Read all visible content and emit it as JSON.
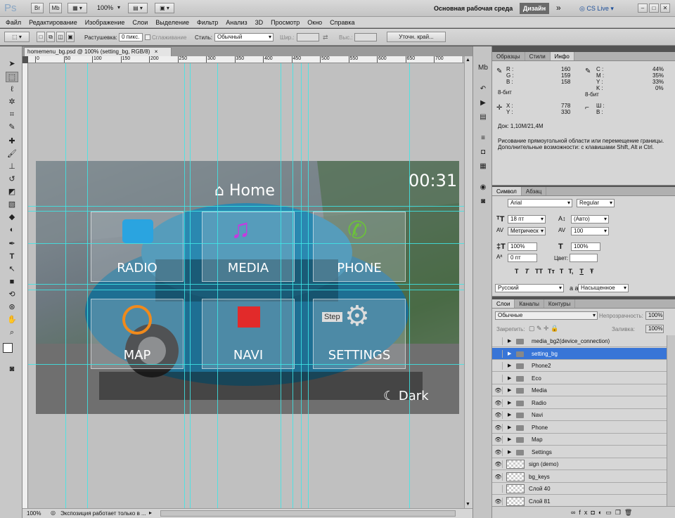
{
  "app": {
    "logo": "Ps",
    "bridge": "Br",
    "mini": "Mb",
    "zoom": "100%",
    "workspace": "Основная рабочая среда",
    "design_btn": "Дизайн",
    "cs_live": "CS Live"
  },
  "menu": [
    "Файл",
    "Редактирование",
    "Изображение",
    "Слои",
    "Выделение",
    "Фильтр",
    "Анализ",
    "3D",
    "Просмотр",
    "Окно",
    "Справка"
  ],
  "options": {
    "feather_label": "Растушевка:",
    "feather_value": "0 пикс.",
    "antialias": "Сглаживание",
    "style_label": "Стиль:",
    "style_value": "Обычный",
    "width_label": "Шир.:",
    "height_label": "Выс.:",
    "refine_btn": "Уточн. край..."
  },
  "document": {
    "tab_title": "homemenu_bg.psd @ 100% (setting_bg, RGB/8)",
    "ruler_marks": [
      "0",
      "50",
      "100",
      "150",
      "200",
      "250",
      "300",
      "350",
      "400",
      "450",
      "500",
      "550",
      "600",
      "650",
      "700",
      "750",
      "800"
    ],
    "status_zoom": "100%",
    "status_text": "Экспозиция работает только в ..."
  },
  "mock_screen": {
    "home": "Home",
    "clock": "00:31",
    "tiles": [
      "RADIO",
      "MEDIA",
      "PHONE",
      "MAP",
      "NAVI",
      "SETTINGS"
    ],
    "dark": "Dark",
    "steps_text": "Step"
  },
  "info_panel": {
    "tabs": [
      "Образцы",
      "Стили",
      "Инфо"
    ],
    "r_label": "R :",
    "r": "160",
    "g_label": "G :",
    "g": "159",
    "b_label": "B :",
    "b": "158",
    "bits1": "8-бит",
    "c_label": "C :",
    "c": "44%",
    "m_label": "M :",
    "m": "35%",
    "y_label": "Y :",
    "y": "33%",
    "k_label": "K :",
    "k": "0%",
    "bits2": "8-бит",
    "x_label": "X :",
    "x": "778",
    "y2_label": "Y :",
    "y2": "330",
    "w_label": "Ш :",
    "h_label": "В :",
    "doc": "Док: 1,10M/21,4M",
    "hint1": "Рисование прямоугольной области или перемещение границы.",
    "hint2": "Дополнительные возможности: с клавишами Shift, Alt и Ctrl."
  },
  "char_panel": {
    "tabs": [
      "Символ",
      "Абзац"
    ],
    "font": "Arial",
    "style": "Regular",
    "size": "18 пт",
    "leading": "(Авто)",
    "kerning": "Метрическ",
    "tracking": "100",
    "vscale": "100%",
    "hscale": "100%",
    "baseline": "0 пт",
    "color_label": "Цвет:",
    "lang": "Русский",
    "aa_label": "a a",
    "aa": "Насыщенное",
    "styles": [
      "T",
      "T",
      "TT",
      "Tт",
      "T",
      "T,",
      "T",
      "Ŧ"
    ]
  },
  "layers_panel": {
    "tabs": [
      "Слои",
      "Каналы",
      "Контуры"
    ],
    "blend": "Обычные",
    "opacity_label": "Непрозрачность:",
    "opacity": "100%",
    "lock_label": "Закрепить:",
    "fill_label": "Заливка:",
    "fill": "100%",
    "layers": [
      {
        "name": "media_bg2(device_connection)",
        "type": "folder",
        "visible": false,
        "selected": false
      },
      {
        "name": "setting_bg",
        "type": "folder",
        "visible": false,
        "selected": true
      },
      {
        "name": "Phone2",
        "type": "folder",
        "visible": false,
        "selected": false
      },
      {
        "name": "Eco",
        "type": "folder",
        "visible": false,
        "selected": false
      },
      {
        "name": "Media",
        "type": "folder",
        "visible": true,
        "selected": false
      },
      {
        "name": "Radio",
        "type": "folder",
        "visible": true,
        "selected": false
      },
      {
        "name": "Navi",
        "type": "folder",
        "visible": true,
        "selected": false
      },
      {
        "name": "Phone",
        "type": "folder",
        "visible": true,
        "selected": false
      },
      {
        "name": "Map",
        "type": "folder",
        "visible": true,
        "selected": false
      },
      {
        "name": "Settings",
        "type": "folder",
        "visible": true,
        "selected": false
      },
      {
        "name": "sign (demo)",
        "type": "layer",
        "visible": true,
        "selected": false
      },
      {
        "name": "bg_keys",
        "type": "layer",
        "visible": true,
        "selected": false
      },
      {
        "name": "Слой 40",
        "type": "layer",
        "visible": false,
        "selected": false
      },
      {
        "name": "Слой 81",
        "type": "layer",
        "visible": true,
        "selected": false
      }
    ]
  },
  "colors": {
    "selection": "#3875d7",
    "guide": "#3ee6e6",
    "ui_bg": "#d6d6d6"
  }
}
